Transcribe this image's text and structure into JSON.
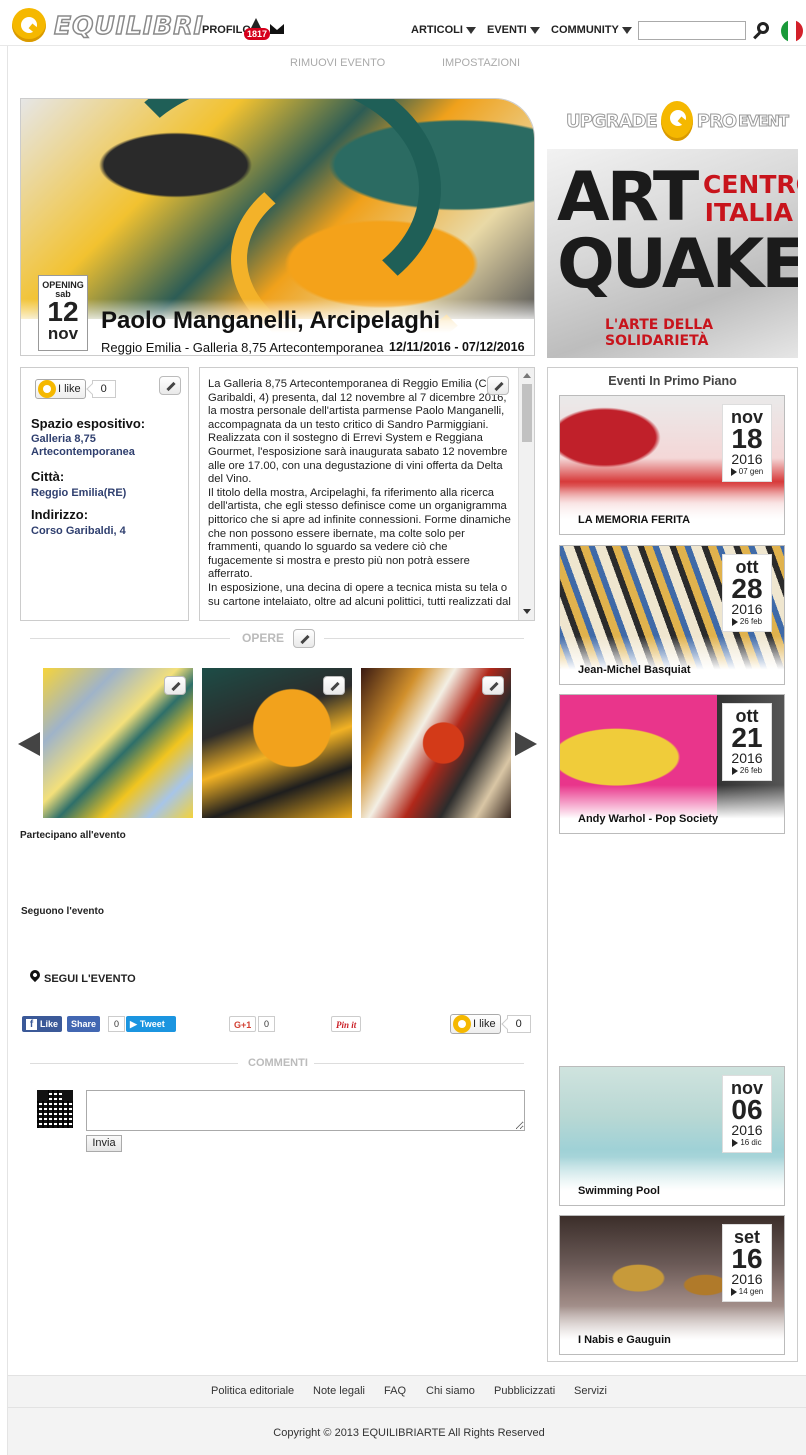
{
  "header": {
    "logo_text": "EQUILIBRI",
    "profilo": "PROFILO",
    "notifications": "1817",
    "menu": [
      "ARTICOLI",
      "EVENTI",
      "COMMUNITY"
    ],
    "search_placeholder": ""
  },
  "sublinks": [
    "RIMUOVI EVENTO",
    "IMPOSTAZIONI"
  ],
  "event": {
    "date_label": "OPENING",
    "weekday": "sab",
    "day": "12",
    "month": "nov",
    "title": "Paolo Manganelli, Arcipelaghi",
    "location": "Reggio Emilia - Galleria 8,75 Artecontemporanea",
    "dates": "12/11/2016 - 07/12/2016"
  },
  "info": {
    "like_label": "I like",
    "like_count": "0",
    "spazio_label": "Spazio espositivo:",
    "spazio_value": "Galleria 8,75 Artecontemporanea",
    "citta_label": "Città:",
    "citta_value": "Reggio Emilia(RE)",
    "indirizzo_label": "Indirizzo:",
    "indirizzo_value": "Corso Garibaldi, 4"
  },
  "description": "La Galleria 8,75 Artecontemporanea di Reggio Emilia (Corso Garibaldi, 4) presenta, dal 12 novembre al 7 dicembre 2016, la mostra personale dell'artista parmense Paolo Manganelli, accompagnata da un testo critico di Sandro Parmiggiani. Realizzata con il sostegno di Errevi System e Reggiana Gourmet, l'esposizione sarà inaugurata sabato 12 novembre alle ore 17.00, con una degustazione di vini offerta da Delta del Vino.\nIl titolo della mostra, Arcipelaghi, fa riferimento alla ricerca dell'artista, che egli stesso definisce come un organigramma pittorico che si apre ad infinite connessioni. Forme dinamiche che non possono essere ibernate, ma colte solo per frammenti, quando lo sguardo sa vedere ciò che fugacemente si mostra e presto più non potrà essere afferrato.\nIn esposizione, una decina di opere a tecnica mista su tela o su cartone intelaiato, oltre ad alcuni polittici, tutti realizzati dal",
  "opere_title": "OPERE",
  "partecipano": "Partecipano all'evento",
  "seguono": "Seguono l'evento",
  "segui": "SEGUI L'EVENTO",
  "social": {
    "fb_like": "Like",
    "fb_share": "Share",
    "fb_count": "0",
    "tweet": "Tweet",
    "gplus": "G+1",
    "gplus_count": "0",
    "pinit": "Pin it",
    "ilike": "I like",
    "ilike_count": "0"
  },
  "commenti_title": "COMMENTI",
  "invia": "Invia",
  "sidebar": {
    "upgrade": [
      "UPGRADE",
      "PRO",
      "EVENT"
    ],
    "ad": {
      "line1": "ART",
      "line2": "QUAKE",
      "centro": "CENTRO ITALIA",
      "sol": "L'ARTE DELLA SOLIDARIETÀ"
    },
    "featured_title": "Eventi In Primo Piano",
    "events": [
      {
        "name": "LA MEMORIA FERITA",
        "month": "nov",
        "day": "18",
        "year": "2016",
        "end": "07 gen"
      },
      {
        "name": "Jean-Michel Basquiat",
        "month": "ott",
        "day": "28",
        "year": "2016",
        "end": "26 feb"
      },
      {
        "name": "Andy Warhol - Pop Society",
        "month": "ott",
        "day": "21",
        "year": "2016",
        "end": "26 feb"
      },
      {
        "name": "Swimming Pool",
        "month": "nov",
        "day": "06",
        "year": "2016",
        "end": "16 dic"
      },
      {
        "name": "I Nabis e Gauguin",
        "month": "set",
        "day": "16",
        "year": "2016",
        "end": "14 gen"
      }
    ]
  },
  "footer": {
    "links": [
      "Politica editoriale",
      "Note legali",
      "FAQ",
      "Chi siamo",
      "Pubblicizzati",
      "Servizi"
    ],
    "copyright": "Copyright © 2013 EQUILIBRIARTE All Rights Reserved"
  }
}
